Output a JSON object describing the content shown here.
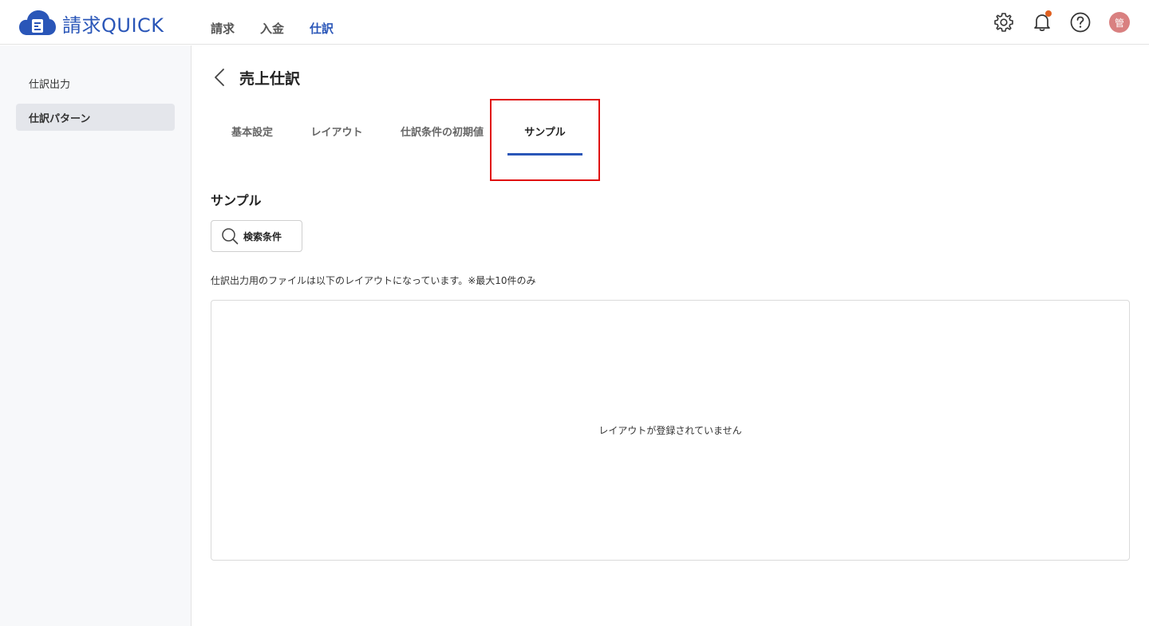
{
  "app": {
    "name": "請求QUICK"
  },
  "nav": [
    {
      "label": "請求"
    },
    {
      "label": "入金"
    },
    {
      "label": "仕訳"
    }
  ],
  "header": {
    "avatar_initial": "管"
  },
  "sidebar": {
    "items": [
      {
        "label": "仕訳出力"
      },
      {
        "label": "仕訳パターン"
      }
    ]
  },
  "page": {
    "title": "売上仕訳"
  },
  "tabs": [
    {
      "label": "基本設定"
    },
    {
      "label": "レイアウト"
    },
    {
      "label": "仕訳条件の初期値"
    },
    {
      "label": "サンプル"
    }
  ],
  "sample": {
    "section_title": "サンプル",
    "search_label": "検索条件",
    "description": "仕訳出力用のファイルは以下のレイアウトになっています。※最大10件のみ",
    "empty_message": "レイアウトが登録されていません"
  },
  "colors": {
    "accent": "#2a56b8",
    "highlight": "#e01010",
    "notification": "#e06020"
  }
}
